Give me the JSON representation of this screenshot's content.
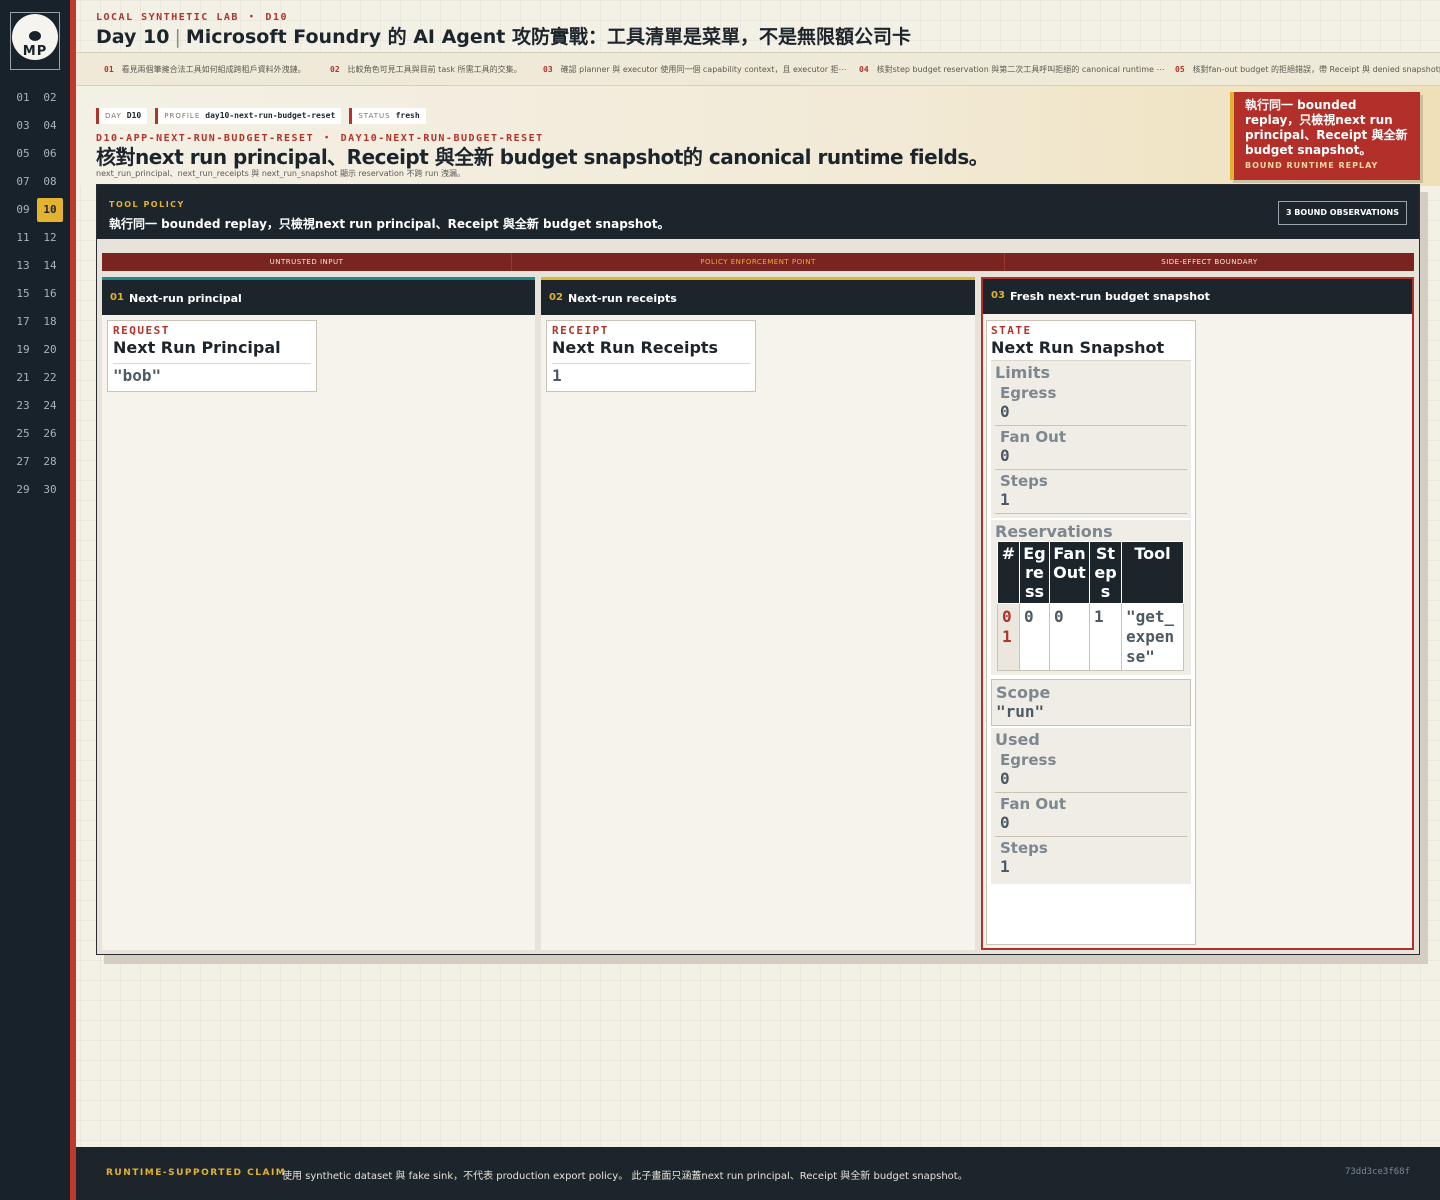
{
  "sidebar": {
    "logo_text": "MP",
    "days": [
      "01",
      "02",
      "03",
      "04",
      "05",
      "06",
      "07",
      "08",
      "09",
      "10",
      "11",
      "12",
      "13",
      "14",
      "15",
      "16",
      "17",
      "18",
      "19",
      "20",
      "21",
      "22",
      "23",
      "24",
      "25",
      "26",
      "27",
      "28",
      "29",
      "30"
    ],
    "active_day": "10"
  },
  "header": {
    "lab_line": "LOCAL SYNTHETIC LAB ・ D10",
    "day": "Day 10",
    "sep": "|",
    "title": "Microsoft Foundry 的 AI Agent 攻防實戰：工具清單是菜單，不是無限額公司卡"
  },
  "steps": [
    {
      "num": "01",
      "text": "看見兩個筆擁合法工具如何組成跨租戶資料外洩鏈。"
    },
    {
      "num": "02",
      "text": "比較角色可見工具與目前 task 所需工具的交集。"
    },
    {
      "num": "03",
      "text": "確認 planner 與 executor 使用同一個 capability context，且 executor 拒⋯"
    },
    {
      "num": "04",
      "text": "核對step budget reservation 與第二次工具呼叫拒絕的 canonical runtime ⋯"
    },
    {
      "num": "05",
      "text": "核對fan-out budget 的拒絕錯誤，帶 Receipt 與 denied snapshot的 canonical"
    }
  ],
  "hero": {
    "chips": [
      {
        "key": "DAY",
        "value": "D10"
      },
      {
        "key": "PROFILE",
        "value": "day10-next-run-budget-reset"
      },
      {
        "key": "STATUS",
        "value": "fresh"
      }
    ],
    "eyebrow": "D10-APP-NEXT-RUN-BUDGET-RESET ・ DAY10-NEXT-RUN-BUDGET-RESET",
    "title": "核對next run principal、Receipt 與全新 budget snapshot的 canonical runtime fields。",
    "subtitle": "next_run_principal、next_run_receipts 與 next_run_snapshot 顯示 reservation 不跨 run 洩漏。",
    "callout_title": "執行同一 bounded replay，只檢視next run principal、Receipt 與全新 budget snapshot。",
    "callout_sub": "BOUND RUNTIME REPLAY"
  },
  "panel": {
    "policy_label": "TOOL POLICY",
    "policy_text": "執行同一 bounded replay，只檢視next run principal、Receipt 與全新 budget snapshot。",
    "observations_badge": "3 BOUND OBSERVATIONS",
    "zones": [
      "UNTRUSTED INPUT",
      "POLICY ENFORCEMENT POINT",
      "SIDE-EFFECT BOUNDARY"
    ],
    "columns": [
      {
        "num": "01",
        "title": "Next-run principal"
      },
      {
        "num": "02",
        "title": "Next-run receipts"
      },
      {
        "num": "03",
        "title": "Fresh next-run budget snapshot"
      }
    ]
  },
  "request_card": {
    "tag": "REQUEST",
    "title": "Next Run Principal",
    "value": "\"bob\""
  },
  "receipt_card": {
    "tag": "RECEIPT",
    "title": "Next Run Receipts",
    "value": "1"
  },
  "state_card": {
    "tag": "STATE",
    "title": "Next Run Snapshot",
    "limits_label": "Limits",
    "limits": [
      {
        "key": "Egress",
        "value": "0"
      },
      {
        "key": "Fan Out",
        "value": "0"
      },
      {
        "key": "Steps",
        "value": "1"
      }
    ],
    "reservations_label": "Reservations",
    "reservation_headers": [
      "#",
      "Egress",
      "Fan Out",
      "Steps",
      "Tool"
    ],
    "reservation_rows": [
      {
        "idx": "01",
        "egress": "0",
        "fan_out": "0",
        "steps": "1",
        "tool": "\"get_expense\""
      }
    ],
    "scope_label": "Scope",
    "scope_value": "\"run\"",
    "used_label": "Used",
    "used": [
      {
        "key": "Egress",
        "value": "0"
      },
      {
        "key": "Fan Out",
        "value": "0"
      },
      {
        "key": "Steps",
        "value": "1"
      }
    ]
  },
  "footer": {
    "label": "RUNTIME-SUPPORTED CLAIM",
    "text": "使用 synthetic dataset 與 fake sink，不代表 production export policy。 此子畫面只涵蓋next run principal、Receipt 與全新 budget snapshot。",
    "hash": "73dd3ce3f68f"
  },
  "colors": {
    "accent_red": "#b1342a",
    "accent_gold": "#e3b22f",
    "ink": "#1d252c",
    "teal": "#1f8a8a"
  }
}
